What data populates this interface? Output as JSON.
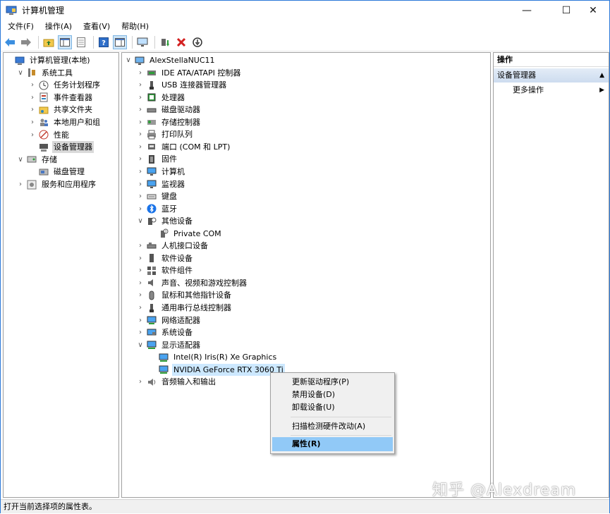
{
  "window": {
    "title": "计算机管理"
  },
  "menu": [
    "文件(F)",
    "操作(A)",
    "查看(V)",
    "帮助(H)"
  ],
  "left_tree": [
    {
      "label": "计算机管理(本地)",
      "level": 0,
      "chev": "",
      "icon": "computer-management-icon"
    },
    {
      "label": "系统工具",
      "level": 1,
      "chev": "v",
      "icon": "system-tools-icon"
    },
    {
      "label": "任务计划程序",
      "level": 2,
      "chev": ">",
      "icon": "task-scheduler-icon"
    },
    {
      "label": "事件查看器",
      "level": 2,
      "chev": ">",
      "icon": "event-viewer-icon"
    },
    {
      "label": "共享文件夹",
      "level": 2,
      "chev": ">",
      "icon": "shared-folder-icon"
    },
    {
      "label": "本地用户和组",
      "level": 2,
      "chev": ">",
      "icon": "local-users-icon"
    },
    {
      "label": "性能",
      "level": 2,
      "chev": ">",
      "icon": "performance-icon"
    },
    {
      "label": "设备管理器",
      "level": 2,
      "chev": "",
      "icon": "device-manager-icon",
      "selected": true
    },
    {
      "label": "存储",
      "level": 1,
      "chev": "v",
      "icon": "storage-icon"
    },
    {
      "label": "磁盘管理",
      "level": 2,
      "chev": "",
      "icon": "disk-management-icon"
    },
    {
      "label": "服务和应用程序",
      "level": 1,
      "chev": ">",
      "icon": "services-icon"
    }
  ],
  "device_tree": [
    {
      "label": "AlexStellaNUC11",
      "level": 0,
      "chev": "v",
      "icon": "computer-icon"
    },
    {
      "label": "IDE ATA/ATAPI 控制器",
      "level": 1,
      "chev": ">",
      "icon": "ide-controller-icon"
    },
    {
      "label": "USB 连接器管理器",
      "level": 1,
      "chev": ">",
      "icon": "usb-icon"
    },
    {
      "label": "处理器",
      "level": 1,
      "chev": ">",
      "icon": "processor-icon"
    },
    {
      "label": "磁盘驱动器",
      "level": 1,
      "chev": ">",
      "icon": "disk-drive-icon"
    },
    {
      "label": "存储控制器",
      "level": 1,
      "chev": ">",
      "icon": "storage-controller-icon"
    },
    {
      "label": "打印队列",
      "level": 1,
      "chev": ">",
      "icon": "printer-icon"
    },
    {
      "label": "端口 (COM 和 LPT)",
      "level": 1,
      "chev": ">",
      "icon": "port-icon"
    },
    {
      "label": "固件",
      "level": 1,
      "chev": ">",
      "icon": "firmware-icon"
    },
    {
      "label": "计算机",
      "level": 1,
      "chev": ">",
      "icon": "monitor-icon"
    },
    {
      "label": "监视器",
      "level": 1,
      "chev": ">",
      "icon": "monitor-icon"
    },
    {
      "label": "键盘",
      "level": 1,
      "chev": ">",
      "icon": "keyboard-icon"
    },
    {
      "label": "蓝牙",
      "level": 1,
      "chev": ">",
      "icon": "bluetooth-icon"
    },
    {
      "label": "其他设备",
      "level": 1,
      "chev": "v",
      "icon": "other-devices-icon"
    },
    {
      "label": "Private COM",
      "level": 2,
      "chev": "",
      "icon": "unknown-device-icon"
    },
    {
      "label": "人机接口设备",
      "level": 1,
      "chev": ">",
      "icon": "hid-icon"
    },
    {
      "label": "软件设备",
      "level": 1,
      "chev": ">",
      "icon": "software-device-icon"
    },
    {
      "label": "软件组件",
      "level": 1,
      "chev": ">",
      "icon": "software-component-icon"
    },
    {
      "label": "声音、视频和游戏控制器",
      "level": 1,
      "chev": ">",
      "icon": "sound-icon"
    },
    {
      "label": "鼠标和其他指针设备",
      "level": 1,
      "chev": ">",
      "icon": "mouse-icon"
    },
    {
      "label": "通用串行总线控制器",
      "level": 1,
      "chev": ">",
      "icon": "usb-icon"
    },
    {
      "label": "网络适配器",
      "level": 1,
      "chev": ">",
      "icon": "network-adapter-icon"
    },
    {
      "label": "系统设备",
      "level": 1,
      "chev": ">",
      "icon": "system-device-icon"
    },
    {
      "label": "显示适配器",
      "level": 1,
      "chev": "v",
      "icon": "display-adapter-icon"
    },
    {
      "label": "Intel(R) Iris(R) Xe Graphics",
      "level": 2,
      "chev": "",
      "icon": "display-adapter-icon"
    },
    {
      "label": "NVIDIA GeForce RTX 3060 Ti",
      "level": 2,
      "chev": "",
      "icon": "display-adapter-icon",
      "hilite": true
    },
    {
      "label": "音频输入和输出",
      "level": 1,
      "chev": ">",
      "icon": "audio-icon"
    }
  ],
  "actions": {
    "header": "操作",
    "section": "设备管理器",
    "more": "更多操作"
  },
  "context_menu": {
    "items": [
      {
        "label": "更新驱动程序(P)",
        "hot": false
      },
      {
        "label": "禁用设备(D)",
        "hot": false
      },
      {
        "label": "卸载设备(U)",
        "hot": false
      },
      {
        "label": "扫描检测硬件改动(A)",
        "hot": false
      },
      {
        "label": "属性(R)",
        "hot": true
      }
    ]
  },
  "status": "打开当前选择项的属性表。",
  "watermark": "知乎 @Alexdream"
}
